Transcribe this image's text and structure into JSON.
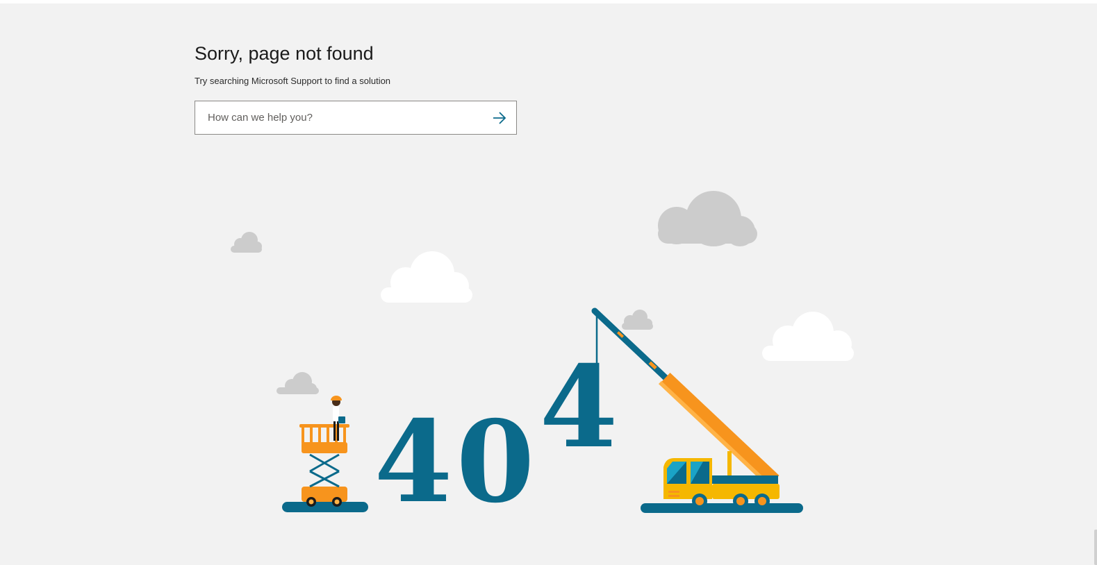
{
  "heading": "Sorry, page not found",
  "subheading": "Try searching Microsoft Support to find a solution",
  "search": {
    "placeholder": "How can we help you?",
    "submit_icon": "arrow-right-icon"
  },
  "illustration": {
    "digits": [
      "4",
      "0",
      "4"
    ],
    "colors": {
      "primary": "#0b6a8b",
      "accent": "#f7941d",
      "accent_light": "#ffb347",
      "yellow": "#f5b700",
      "cloud_gray": "#cccccc",
      "cloud_white": "#ffffff"
    }
  }
}
